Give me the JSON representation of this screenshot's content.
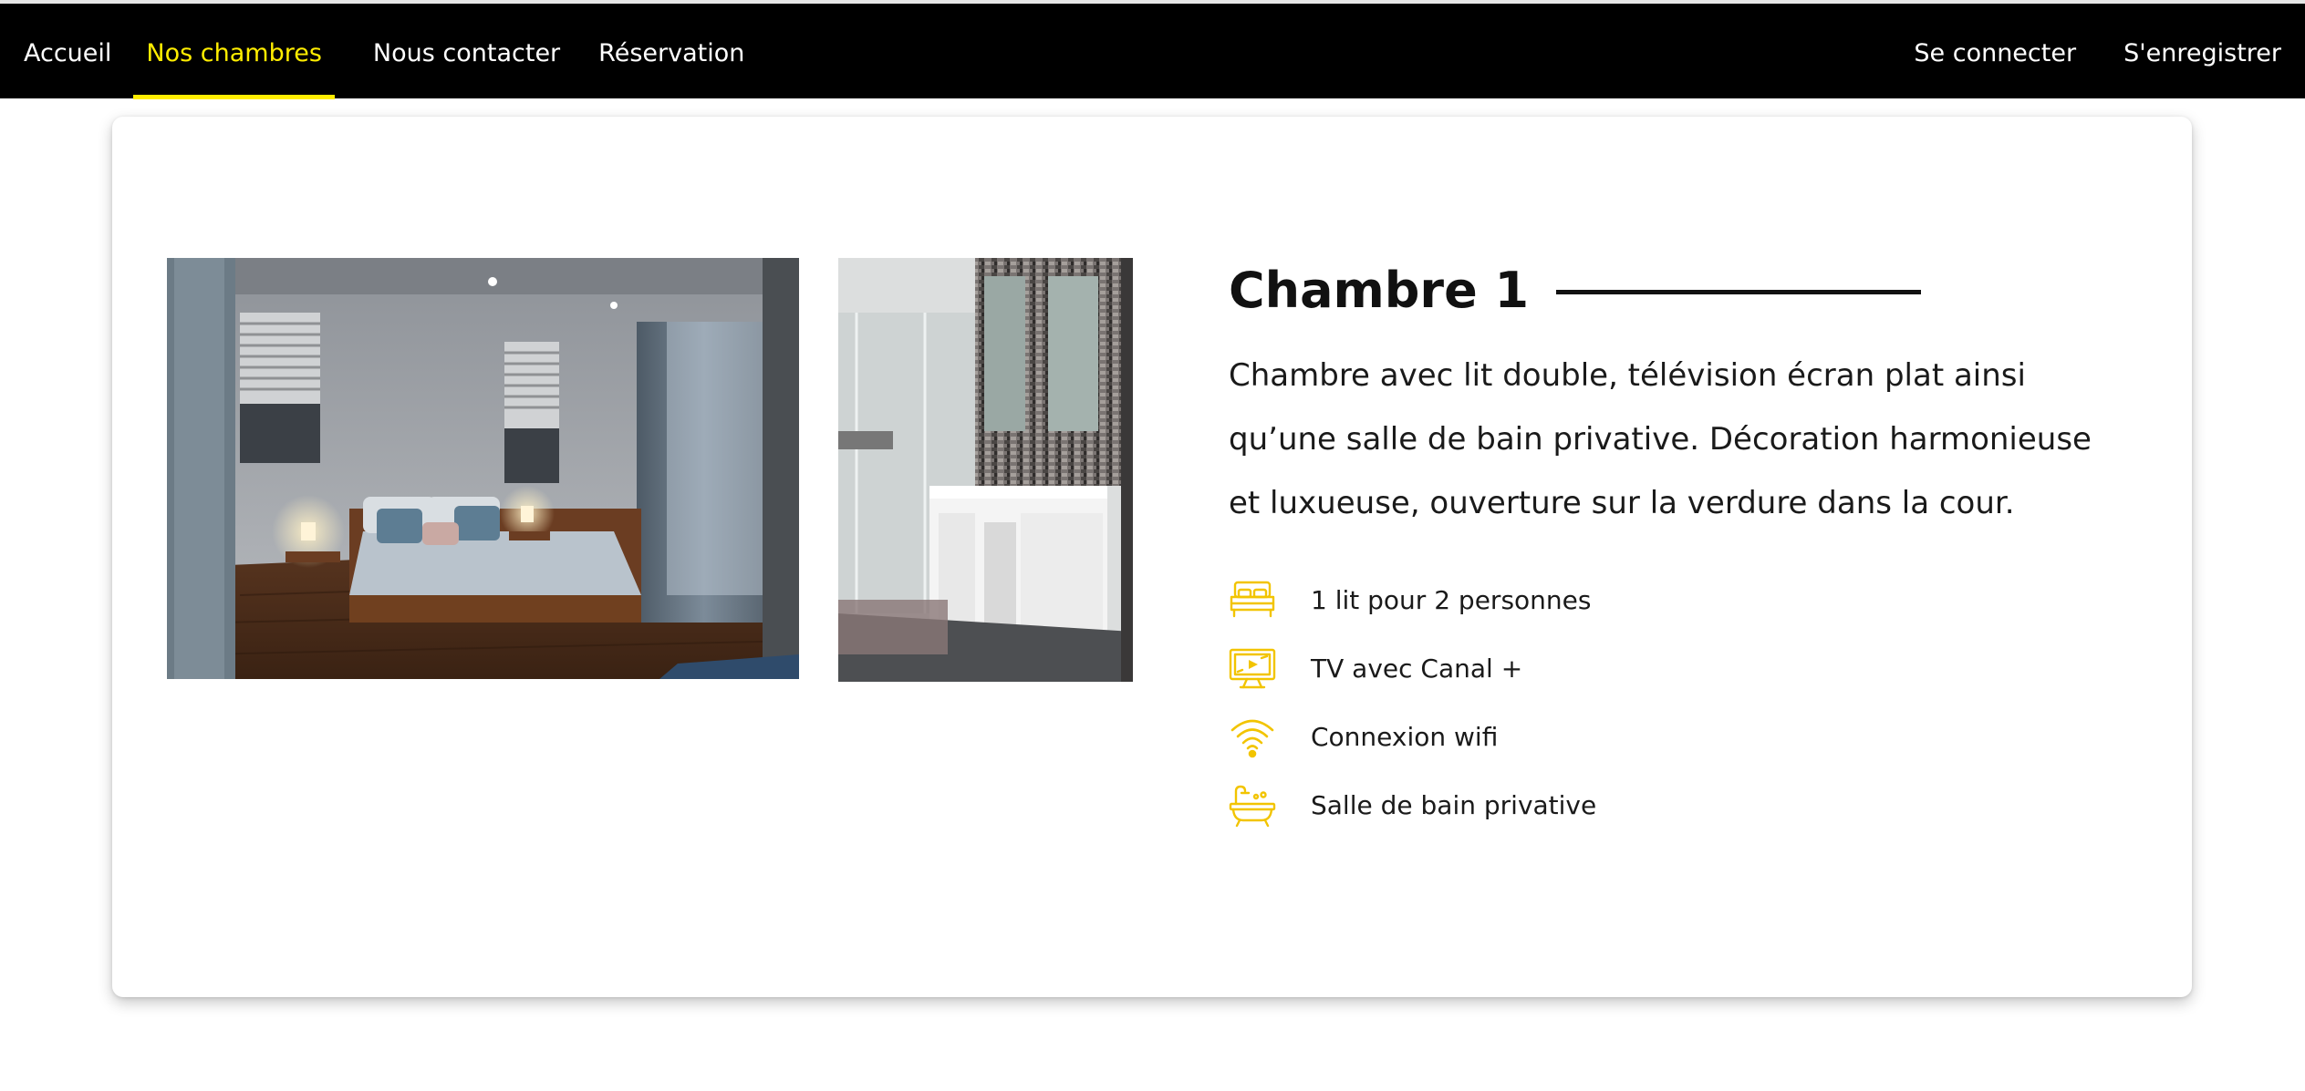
{
  "nav": {
    "left": [
      {
        "label": "Accueil",
        "active": false
      },
      {
        "label": "Nos chambres",
        "active": true
      },
      {
        "label": "Nous contacter",
        "active": false
      },
      {
        "label": "Réservation",
        "active": false
      }
    ],
    "right": [
      {
        "label": "Se connecter"
      },
      {
        "label": "S'enregistrer"
      }
    ]
  },
  "room": {
    "title": "Chambre 1",
    "description": "Chambre avec lit double, télévision écran plat ainsi qu’une salle de bain privative. Décoration harmonieuse et luxueuse, ouverture sur la verdure dans la cour.",
    "features": [
      {
        "icon": "bed-icon",
        "label": "1 lit pour 2 personnes"
      },
      {
        "icon": "tv-icon",
        "label": "TV avec Canal +"
      },
      {
        "icon": "wifi-icon",
        "label": "Connexion wifi"
      },
      {
        "icon": "bathtub-icon",
        "label": "Salle de bain privative"
      }
    ]
  },
  "colors": {
    "accent": "#ffed00",
    "navbar": "#000000",
    "icon": "#f2c400"
  }
}
